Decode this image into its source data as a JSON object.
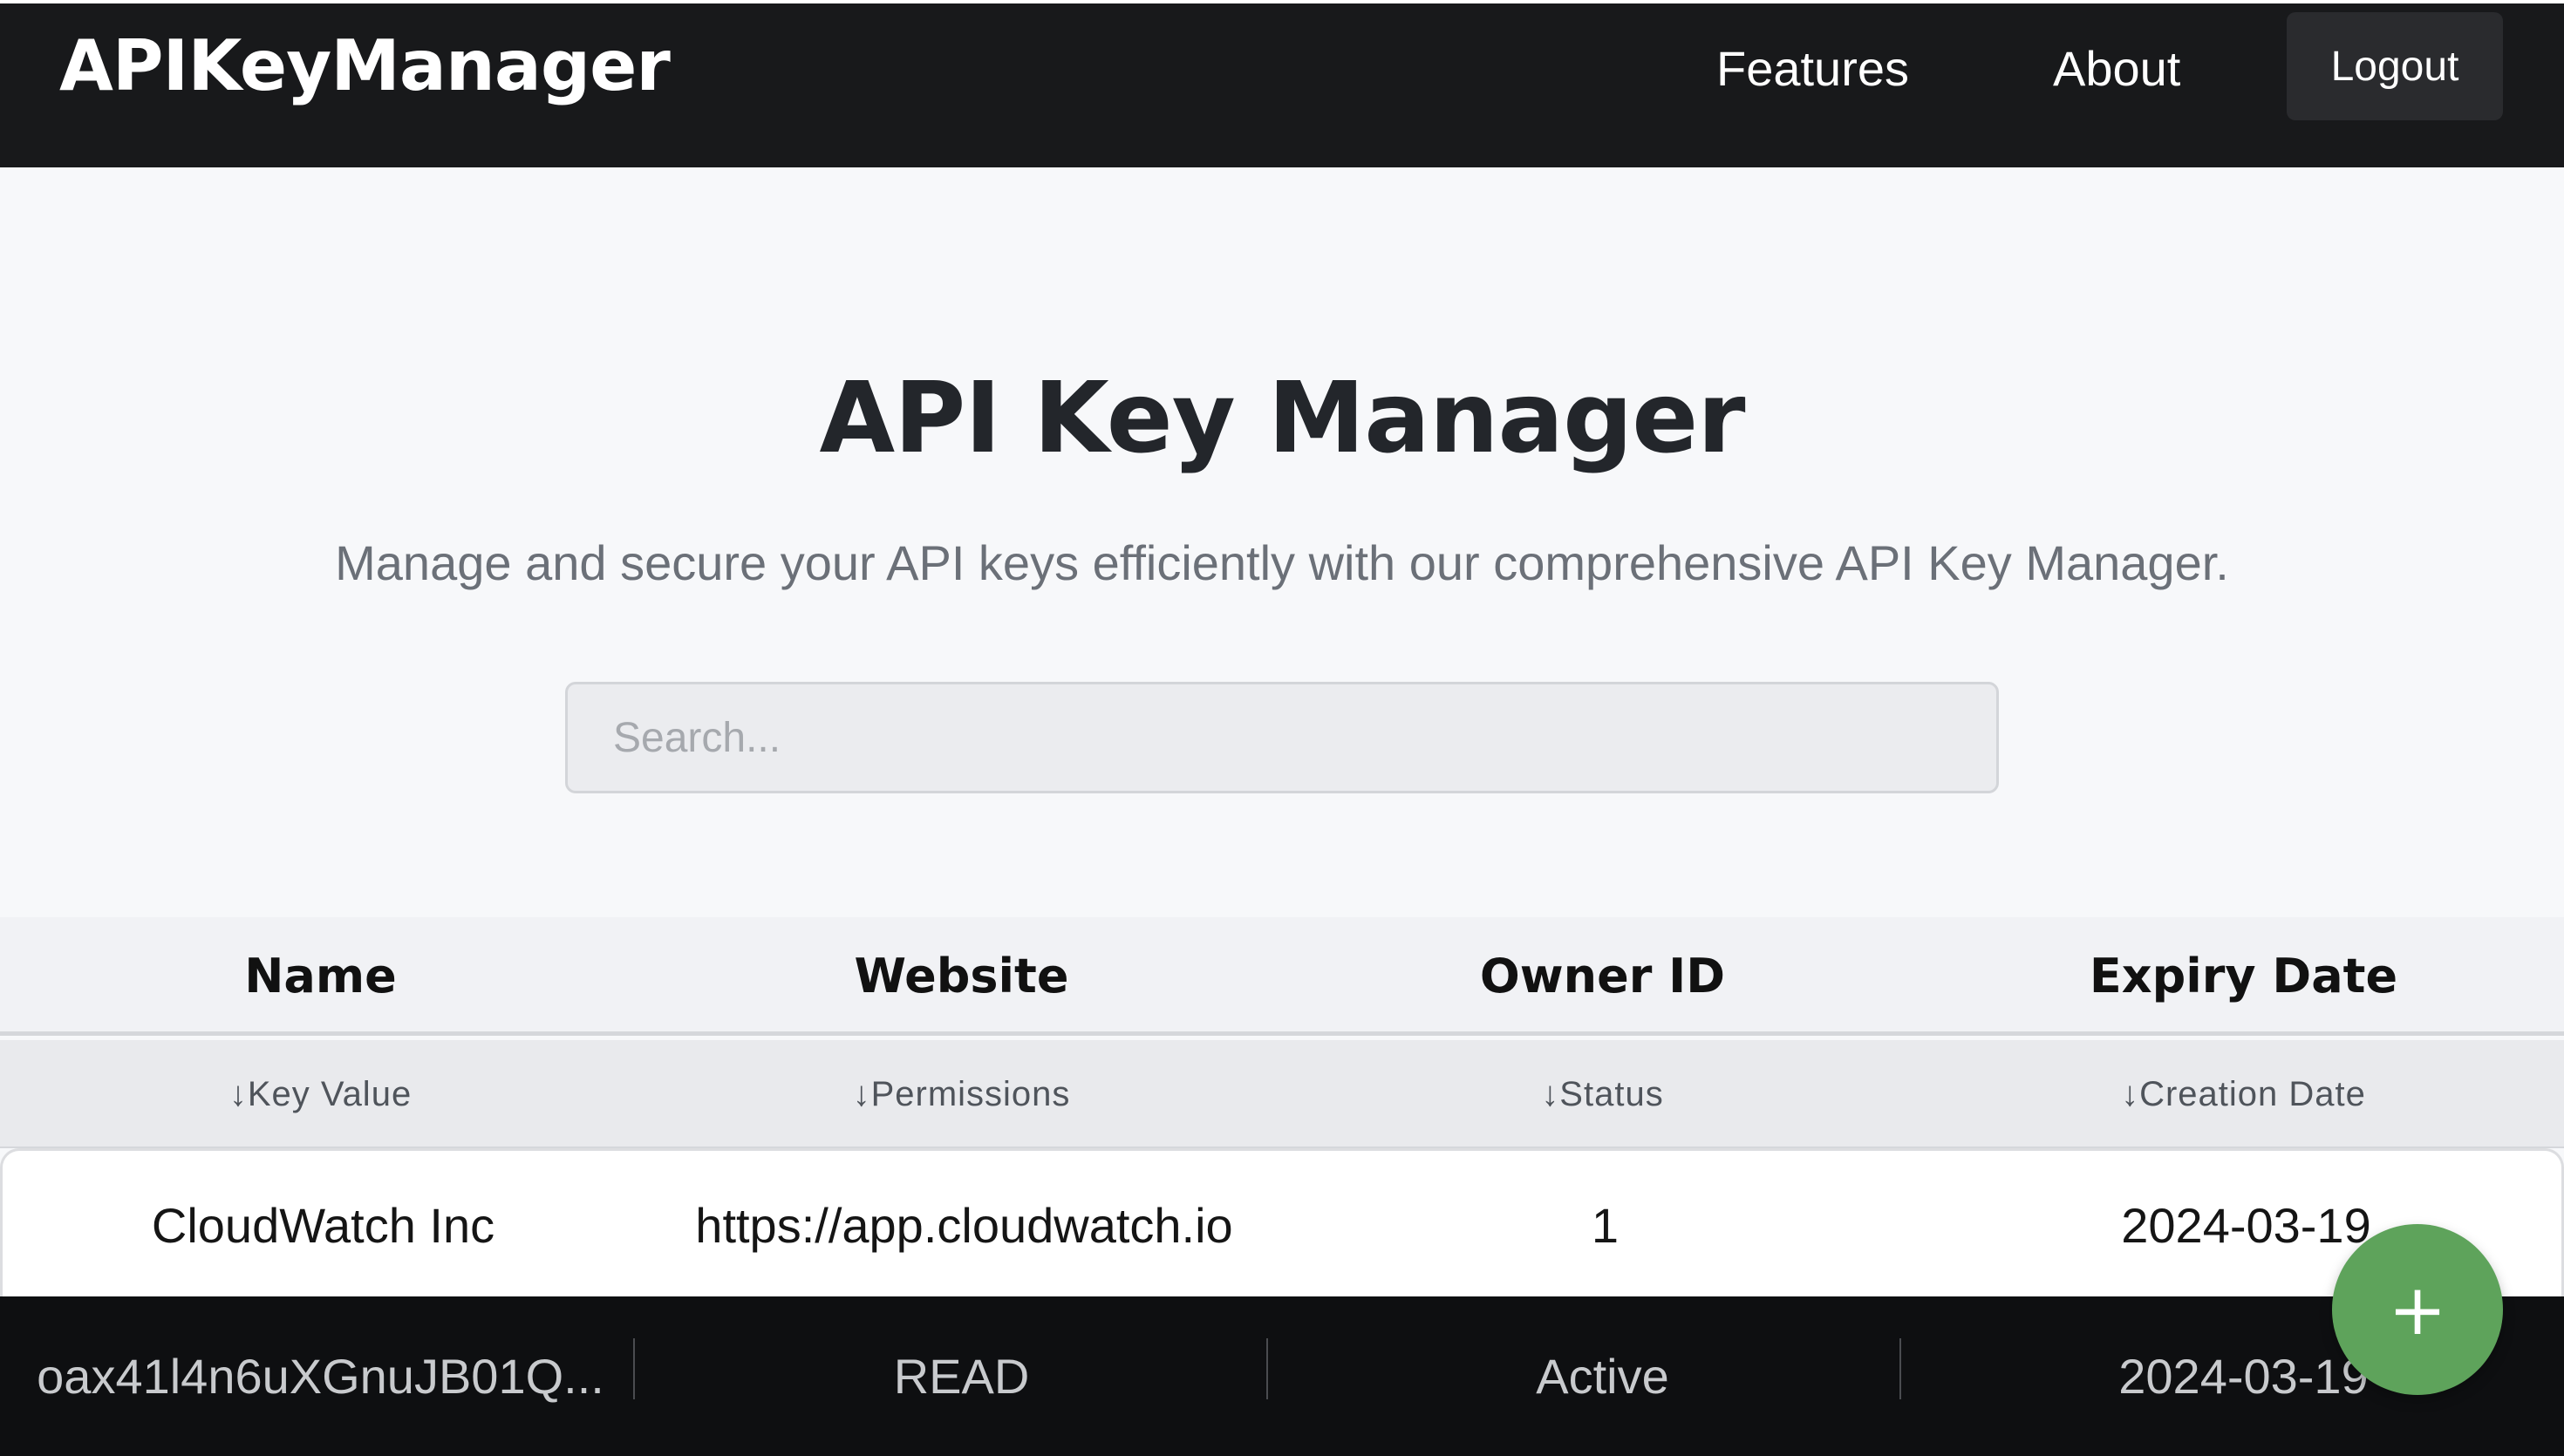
{
  "navbar": {
    "brand": "APIKeyManager",
    "links": [
      "Features",
      "About"
    ],
    "logout_label": "Logout"
  },
  "hero": {
    "title": "API Key Manager",
    "subtitle": "Manage and secure your API keys efficiently with our comprehensive API Key Manager."
  },
  "search": {
    "placeholder": "Search..."
  },
  "table": {
    "columns": [
      "Name",
      "Website",
      "Owner ID",
      "Expiry Date"
    ],
    "subcolumns": [
      "↓Key Value",
      "↓Permissions",
      "↓Status",
      "↓Creation Date"
    ],
    "rows": [
      {
        "main": [
          "CloudWatch Inc",
          "https://app.cloudwatch.io",
          "1",
          "2024-03-19"
        ],
        "detail": [
          "oax41l4n6uXGnuJB01Q...",
          "READ",
          "Active",
          "2024-03-19"
        ]
      }
    ]
  },
  "fab": {
    "label": "+",
    "color": "#5ea35b"
  },
  "colors": {
    "navbar_bg": "#18191b",
    "page_bg": "#f7f8fa",
    "detail_row_bg": "#0e0f11"
  }
}
